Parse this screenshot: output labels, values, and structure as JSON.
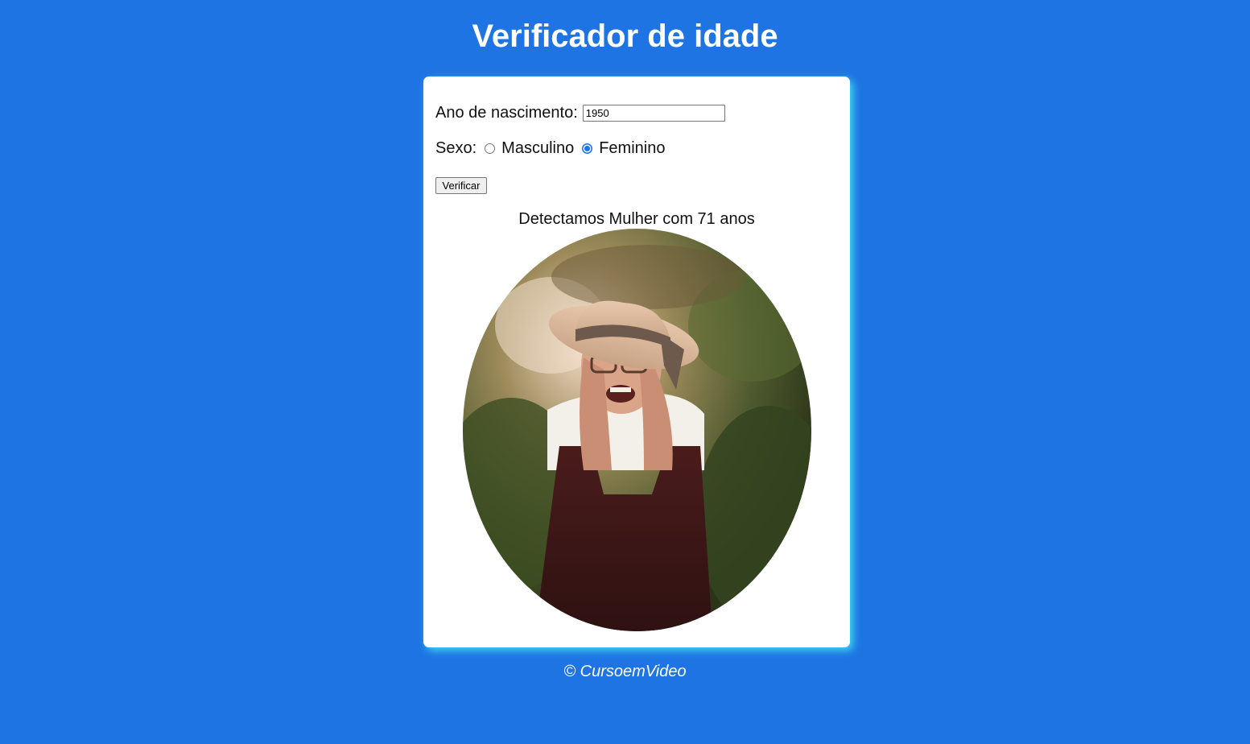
{
  "header": {
    "title": "Verificador de idade"
  },
  "form": {
    "year_label": "Ano de nascimento:",
    "year_value": "1950",
    "sex_label": "Sexo:",
    "sex_options": [
      {
        "label": "Masculino",
        "checked": false
      },
      {
        "label": "Feminino",
        "checked": true
      }
    ],
    "verify_button": "Verificar"
  },
  "result": {
    "text": "Detectamos Mulher com 71 anos",
    "image_description_icon": "photo-elderly-woman-icon"
  },
  "footer": {
    "text": "© CursoemVideo"
  },
  "colors": {
    "background": "#1e74e2",
    "card": "#ffffff",
    "card_shadow": "#3fd7f2",
    "radio_accent": "#1a73e8"
  }
}
